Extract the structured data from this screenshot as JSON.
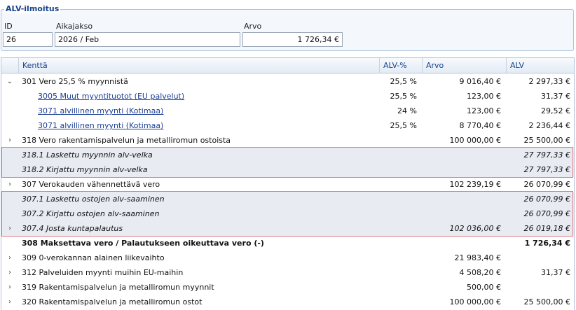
{
  "panel": {
    "title": "ALV-ilmoitus",
    "id_label": "ID",
    "id_value": "26",
    "period_label": "Aikajakso",
    "period_value": "2026 / Feb",
    "value_label": "Arvo",
    "value_value": "1 726,34 €"
  },
  "table": {
    "headers": {
      "field": "Kenttä",
      "pct": "ALV-%",
      "value": "Arvo",
      "alv": "ALV"
    },
    "rows": [
      {
        "arrow": "⌄",
        "field": "301 Vero 25,5 % myynnistä",
        "pct": "25,5 %",
        "value": "9 016,40 €",
        "alv": "2 297,33 €"
      },
      {
        "arrow": "",
        "field": "3005 Muut myyntituotot (EU palvelut)",
        "pct": "25,5 %",
        "value": "123,00 €",
        "alv": "31,37 €"
      },
      {
        "arrow": "",
        "field": "3071 alvillinen myynti (Kotimaa)",
        "pct": "24 %",
        "value": "123,00 €",
        "alv": "29,52 €"
      },
      {
        "arrow": "",
        "field": "3071 alvillinen myynti (Kotimaa)",
        "pct": "25,5 %",
        "value": "8 770,40 €",
        "alv": "2 236,44 €"
      },
      {
        "arrow": "›",
        "field": "318 Vero rakentamispalvelun ja metalliromun ostoista",
        "pct": "",
        "value": "100 000,00 €",
        "alv": "25 500,00 €"
      },
      {
        "arrow": "",
        "field": "318.1 Laskettu myynnin alv-velka",
        "pct": "",
        "value": "",
        "alv": "27 797,33 €"
      },
      {
        "arrow": "",
        "field": "318.2 Kirjattu myynnin alv-velka",
        "pct": "",
        "value": "",
        "alv": "27 797,33 €"
      },
      {
        "arrow": "›",
        "field": "307 Verokauden vähennettävä vero",
        "pct": "",
        "value": "102 239,19 €",
        "alv": "26 070,99 €"
      },
      {
        "arrow": "",
        "field": "307.1 Laskettu ostojen alv-saaminen",
        "pct": "",
        "value": "",
        "alv": "26 070,99 €"
      },
      {
        "arrow": "",
        "field": "307.2 Kirjattu ostojen alv-saaminen",
        "pct": "",
        "value": "",
        "alv": "26 070,99 €"
      },
      {
        "arrow": "›",
        "field": "307.4 Josta kuntapalautus",
        "pct": "",
        "value": "102 036,00 €",
        "alv": "26 019,18 €"
      },
      {
        "arrow": "",
        "field": "308 Maksettava vero / Palautukseen oikeuttava vero (-)",
        "pct": "",
        "value": "",
        "alv": "1 726,34 €"
      },
      {
        "arrow": "›",
        "field": "309 0-verokannan alainen liikevaihto",
        "pct": "",
        "value": "21 983,40 €",
        "alv": ""
      },
      {
        "arrow": "›",
        "field": "312 Palveluiden myynti muihin EU-maihin",
        "pct": "",
        "value": "4 508,20 €",
        "alv": "31,37 €"
      },
      {
        "arrow": "›",
        "field": "319 Rakentamispalvelun ja metalliromun myynnit",
        "pct": "",
        "value": "500,00 €",
        "alv": ""
      },
      {
        "arrow": "›",
        "field": "320 Rakentamispalvelun ja metalliromun ostot",
        "pct": "",
        "value": "100 000,00 €",
        "alv": "25 500,00 €"
      }
    ]
  }
}
